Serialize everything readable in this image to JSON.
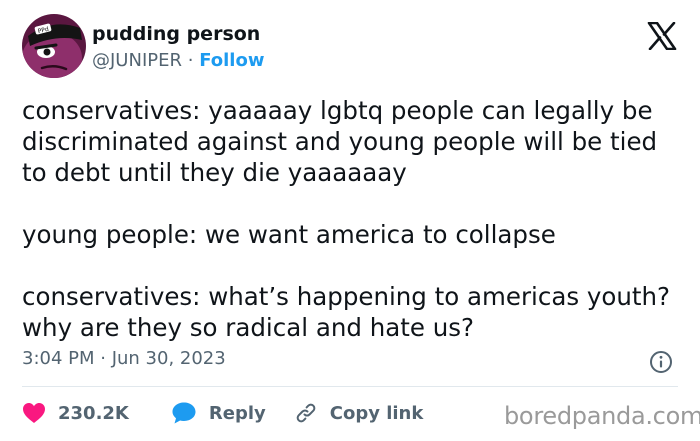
{
  "author": {
    "name": "pudding person",
    "handle": "@JUNIPER",
    "separator": "·",
    "follow_label": "Follow"
  },
  "avatar": {
    "icon": "avatar-character-icon",
    "badge_text": "PPd"
  },
  "tweet": {
    "paragraphs": [
      "conservatives:  yaaaaay lgbtq people can legally be discriminated against and young people will be tied to debt until they die yaaaaaay",
      "young people:  we want america to collapse",
      "conservatives:  what’s happening to americas youth?  why are they so radical and hate us?"
    ]
  },
  "timestamp": "3:04 PM · Jun 30, 2023",
  "actions": {
    "like_count": "230.2K",
    "reply_label": "Reply",
    "copy_link_label": "Copy link"
  },
  "watermark": "boredpanda.com",
  "icons": {
    "platform": "x-logo-icon",
    "info": "info-icon",
    "like": "heart-icon",
    "reply": "speech-bubble-icon",
    "copy": "link-icon"
  },
  "colors": {
    "like": "#f91880",
    "reply": "#1d9bf0",
    "link": "#1d9bf0",
    "secondary_text": "#536471",
    "avatar_bg": "#5a1740"
  }
}
